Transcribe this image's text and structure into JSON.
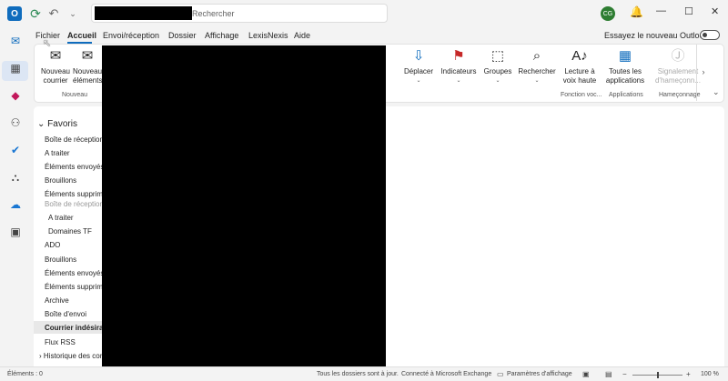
{
  "titlebar": {
    "app_logo": "O",
    "search_placeholder": "Rechercher",
    "avatar_initials": "CG",
    "icons": [
      "outlook-logo",
      "sync-icon",
      "undo-icon",
      "bell-icon",
      "minimize-icon",
      "maximize-icon",
      "close-icon"
    ]
  },
  "menu": {
    "items": [
      "Fichier",
      "Accueil",
      "Envoi/réception",
      "Dossier",
      "Affichage",
      "LexisNexis",
      "Aide"
    ],
    "active": "Accueil",
    "try_new": "Essayez le nouveau Outlook"
  },
  "ribbon": {
    "new_mail": [
      "Nouveau",
      "courrier"
    ],
    "new_items": [
      "Nouveaux",
      "éléments"
    ],
    "group_new": "Nouveau",
    "move": "Déplacer",
    "tags": "Indicateurs",
    "groups": "Groupes",
    "find": "Rechercher",
    "read_aloud": [
      "Lecture à",
      "voix haute"
    ],
    "group_voice": "Fonction voc...",
    "all_apps": [
      "Toutes les",
      "applications"
    ],
    "group_apps": "Applications",
    "report_phish": [
      "Signalement",
      "d'hameçonn..."
    ],
    "group_phish": "Hameçonnage"
  },
  "folders": {
    "favorites_header": "Favoris",
    "items": [
      "Boîte de réception",
      "A traiter",
      "Éléments envoyés",
      "Brouillons",
      "Éléments supprimés",
      "Boîte de réception",
      "A traiter",
      "Domaines TF",
      "ADO",
      "Brouillons",
      "Éléments envoyés",
      "Éléments supprimés",
      "Archive",
      "Boîte d'envoi",
      "Courrier indésirable",
      "Flux RSS",
      "Historique des conversations"
    ],
    "selected": "Courrier indésirable"
  },
  "status": {
    "items_count": "Éléments : 0",
    "sync": "Tous les dossiers sont à jour.",
    "connection": "Connecté à Microsoft Exchange",
    "display_settings": "Paramètres d'affichage",
    "zoom": "100 %"
  },
  "colors": {
    "accent": "#0f6cbd",
    "avatar": "#2e7d32",
    "background": "#f3f3f3"
  }
}
